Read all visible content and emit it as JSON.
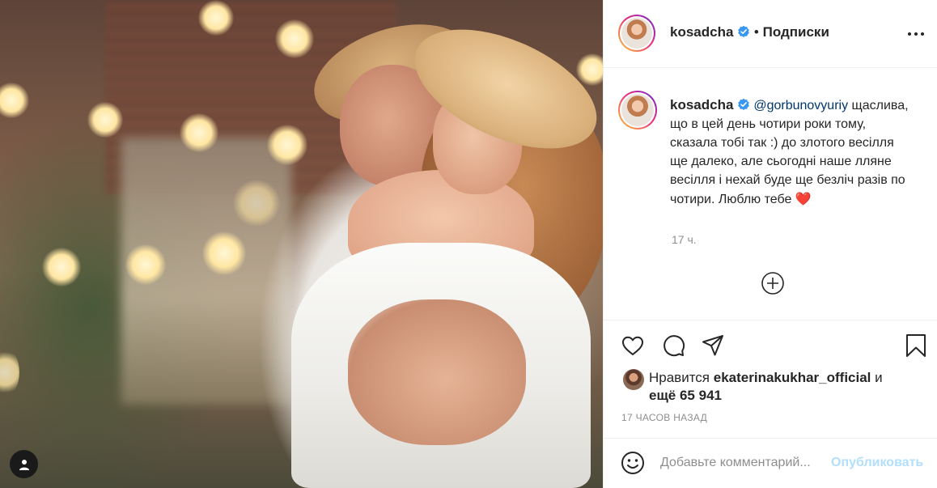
{
  "photo": {
    "alt_icon": "user-tag-icon"
  },
  "header": {
    "username": "kosadcha",
    "verified_icon": "verified-badge-icon",
    "separator": "•",
    "follow_label": "Подписки",
    "more_icon": "more-options-icon"
  },
  "caption": {
    "username": "kosadcha",
    "mention": "@gorbunovyuriy",
    "text": "щаслива, що в цей день чотири роки тому, сказала тобі так :) до злотого весілля ще далеко, але сьогодні наше лляне весілля і нехай буде ще безліч разів по чотири. Люблю тебе",
    "emoji": "❤️",
    "time": "17 ч."
  },
  "load_more_icon": "plus-circle-icon",
  "actions": {
    "like_icon": "heart-icon",
    "comment_icon": "comment-icon",
    "share_icon": "share-icon",
    "save_icon": "bookmark-icon"
  },
  "likes": {
    "prefix": "Нравится",
    "liker": "ekaterinakukhar_official",
    "conjunction": "и",
    "others": "ещё 65 941"
  },
  "post_date": "17 ЧАСОВ НАЗАД",
  "comment": {
    "emoji_icon": "smiley-icon",
    "placeholder": "Добавьте комментарий...",
    "publish_label": "Опубликовать"
  },
  "colors": {
    "text": "#262626",
    "secondary": "#8e8e8e",
    "mention": "#00376b",
    "verified": "#3897f0",
    "publish_disabled": "#b2dffc",
    "heart": "#ed4956"
  }
}
